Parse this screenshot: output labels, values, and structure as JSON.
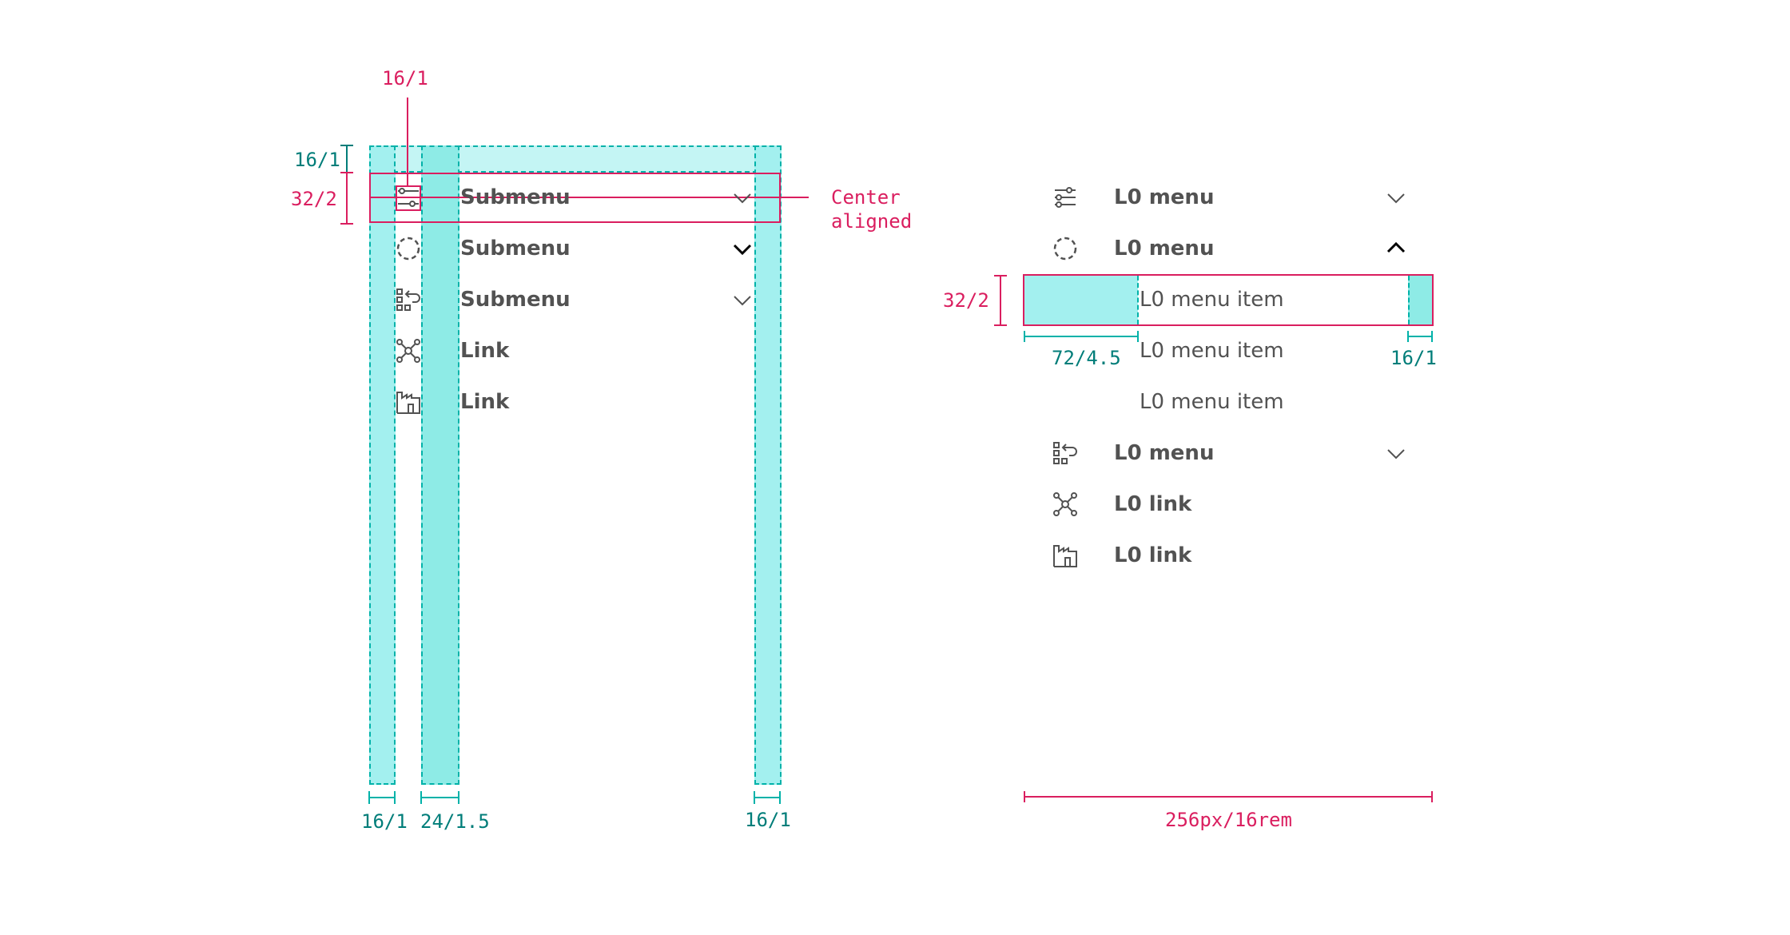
{
  "left_menu": {
    "items": [
      {
        "label": "Submenu",
        "icon": "settings-adjust-icon",
        "chevron": "down"
      },
      {
        "label": "Submenu",
        "icon": "circle-dash-icon",
        "chevron": "down"
      },
      {
        "label": "Submenu",
        "icon": "apps-return-icon",
        "chevron": "down"
      },
      {
        "label": "Link",
        "icon": "network-icon",
        "chevron": ""
      },
      {
        "label": "Link",
        "icon": "building-icon",
        "chevron": ""
      }
    ]
  },
  "right_menu": {
    "items": [
      {
        "label": "L0 menu",
        "icon": "settings-adjust-icon",
        "chevron": "down"
      },
      {
        "label": "L0 menu",
        "icon": "circle-dash-icon",
        "chevron": "up"
      },
      {
        "label": "L0 menu item"
      },
      {
        "label": "L0 menu item"
      },
      {
        "label": "L0 menu item"
      },
      {
        "label": "L0 menu",
        "icon": "apps-return-icon",
        "chevron": "down"
      },
      {
        "label": "L0 link",
        "icon": "network-icon"
      },
      {
        "label": "L0 link",
        "icon": "building-icon"
      }
    ]
  },
  "annotations": {
    "icon_top": "16/1",
    "top_padding": "16/1",
    "row_height_left": "32/2",
    "center_aligned": "Center\naligned",
    "bottom_left": "16/1",
    "bottom_icon": "24/1.5",
    "bottom_right": "16/1",
    "row_height_right": "32/2",
    "indent": "72/4.5",
    "right_padding": "16/1",
    "width": "256px/16rem"
  },
  "colors": {
    "accent_teal": "#00b2a9",
    "fill_teal": "#a3f0ef",
    "annotation_pink": "#da1e5f",
    "annotation_teal": "#007d79",
    "text": "#525252"
  }
}
